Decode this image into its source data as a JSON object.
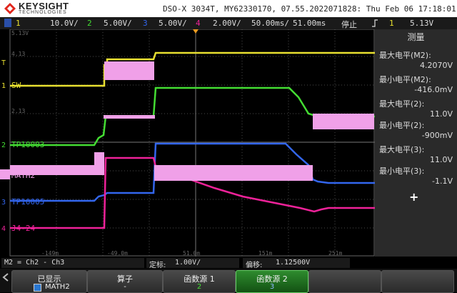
{
  "header": {
    "brand": "KEYSIGHT",
    "brand_sub": "TECHNOLOGIES",
    "model_line": "DSO-X 3034T, MY62330170, 07.55.2022071828: Thu Feb 06 17:18:01 2025"
  },
  "toolbar": {
    "ch1_num": "1",
    "ch1_scale": "10.0V/",
    "ch2_num": "2",
    "ch2_scale": "5.00V/",
    "ch3_num": "3",
    "ch3_scale": "5.00V/",
    "ch4_num": "4",
    "ch4_scale": "2.00V/",
    "timebase": "50.00ms/",
    "delay": "51.00ms",
    "run_state": "停止",
    "trig_ch": "1",
    "trig_level": "5.13V"
  },
  "graticule": {
    "top_left_label": "5.13V",
    "y_labels": [
      "4.13",
      "2.13"
    ],
    "x_labels": [
      "-149m",
      "-49.0m",
      "51.0m",
      "151m",
      "251m"
    ]
  },
  "channels": {
    "sw": "SW",
    "tp10003": "TP10003",
    "math2": "MATH2",
    "tp10005": "TP10005",
    "j4": "J4-24",
    "marker_t": "T",
    "marker_1": "1",
    "marker_2": "2",
    "marker_3": "3",
    "marker_4": "4"
  },
  "measure": {
    "title": "测量",
    "items": [
      {
        "label": "最大电平(M2):",
        "value": "4.2070V"
      },
      {
        "label": "最小电平(M2):",
        "value": "-416.0mV"
      },
      {
        "label": "最大电平(2):",
        "value": "11.0V"
      },
      {
        "label": "最小电平(2):",
        "value": "-900mV"
      },
      {
        "label": "最大电平(3):",
        "value": "11.0V"
      },
      {
        "label": "最小电平(3):",
        "value": "-1.1V"
      }
    ],
    "add": "+"
  },
  "statusbar": {
    "math_def": "M2 = Ch2 - Ch3",
    "scale_label": "定标:",
    "scale_value": "1.00V/",
    "offset_label": "偏移:",
    "offset_value": "1.12500V"
  },
  "softkeys": [
    {
      "l1": "已显示",
      "l2": "MATH2"
    },
    {
      "l1": "算子",
      "l2": "-"
    },
    {
      "l1": "函数源 1",
      "l2": "2"
    },
    {
      "l1": "函数源 2",
      "l2": "3"
    }
  ],
  "colors": {
    "ch1": "#e8e030",
    "ch2": "#44dd33",
    "ch3": "#3366ee",
    "ch4": "#ee2299",
    "math": "#f0a0e8",
    "grid": "#555555"
  }
}
